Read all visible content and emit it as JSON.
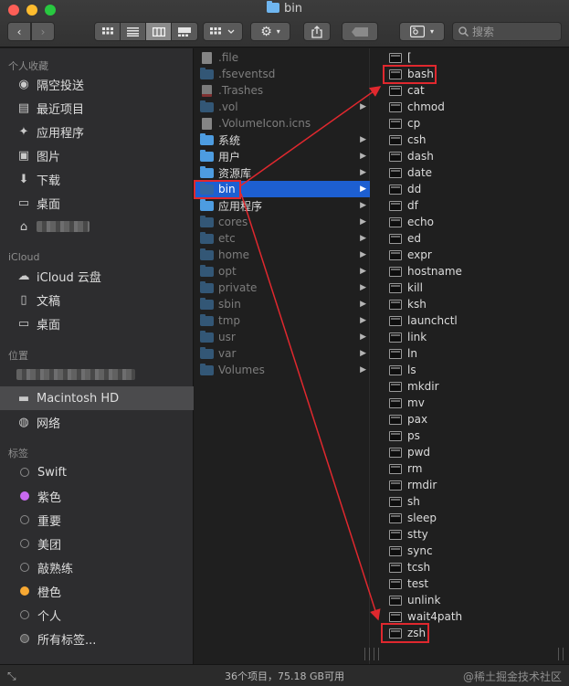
{
  "window": {
    "title": "bin"
  },
  "toolbar": {
    "back_glyph": "‹",
    "forward_glyph": "›",
    "search_placeholder": "搜索"
  },
  "sidebar": {
    "favorites_header": "个人收藏",
    "favorites": [
      {
        "label": "隔空投送",
        "icon": "airdrop-icon"
      },
      {
        "label": "最近项目",
        "icon": "recents-icon"
      },
      {
        "label": "应用程序",
        "icon": "applications-icon"
      },
      {
        "label": "图片",
        "icon": "pictures-icon"
      },
      {
        "label": "下载",
        "icon": "downloads-icon"
      },
      {
        "label": "桌面",
        "icon": "desktop-icon"
      },
      {
        "label": "",
        "icon": "home-icon"
      }
    ],
    "icloud_header": "iCloud",
    "icloud": [
      {
        "label": "iCloud 云盘",
        "icon": "cloud-icon"
      },
      {
        "label": "文稿",
        "icon": "documents-icon"
      },
      {
        "label": "桌面",
        "icon": "desktop-icon"
      }
    ],
    "locations_header": "位置",
    "locations": [
      {
        "label": "",
        "icon": "computer-icon"
      },
      {
        "label": "Macintosh HD",
        "icon": "disk-icon",
        "selected": true
      },
      {
        "label": "网络",
        "icon": "network-icon"
      }
    ],
    "tags_header": "标签",
    "tags": [
      {
        "label": "Swift",
        "color": "none"
      },
      {
        "label": "紫色",
        "color": "#c96af0"
      },
      {
        "label": "重要",
        "color": "none"
      },
      {
        "label": "美团",
        "color": "none"
      },
      {
        "label": "敲熟练",
        "color": "none"
      },
      {
        "label": "橙色",
        "color": "#f7a833"
      },
      {
        "label": "个人",
        "color": "none"
      },
      {
        "label": "所有标签...",
        "color": "multi"
      }
    ]
  },
  "column1": {
    "items": [
      {
        "name": ".file",
        "kind": "doc",
        "hidden": true
      },
      {
        "name": ".fseventsd",
        "kind": "folder",
        "hidden": true
      },
      {
        "name": ".Trashes",
        "kind": "trash",
        "hidden": true
      },
      {
        "name": ".vol",
        "kind": "folder",
        "hidden": true,
        "chevron": true
      },
      {
        "name": ".VolumeIcon.icns",
        "kind": "doc",
        "hidden": true
      },
      {
        "name": "系统",
        "kind": "folder",
        "chevron": true
      },
      {
        "name": "用户",
        "kind": "folder",
        "chevron": true
      },
      {
        "name": "资源库",
        "kind": "folder",
        "chevron": true
      },
      {
        "name": "bin",
        "kind": "folder",
        "chevron": true,
        "selected": true
      },
      {
        "name": "应用程序",
        "kind": "folder",
        "chevron": true
      },
      {
        "name": "cores",
        "kind": "folder",
        "hidden": true,
        "chevron": true
      },
      {
        "name": "etc",
        "kind": "folder",
        "hidden": true,
        "chevron": true
      },
      {
        "name": "home",
        "kind": "folder",
        "hidden": true,
        "chevron": true
      },
      {
        "name": "opt",
        "kind": "folder",
        "hidden": true,
        "chevron": true
      },
      {
        "name": "private",
        "kind": "folder",
        "hidden": true,
        "chevron": true
      },
      {
        "name": "sbin",
        "kind": "folder",
        "hidden": true,
        "chevron": true
      },
      {
        "name": "tmp",
        "kind": "folder",
        "hidden": true,
        "chevron": true
      },
      {
        "name": "usr",
        "kind": "folder",
        "hidden": true,
        "chevron": true
      },
      {
        "name": "var",
        "kind": "folder",
        "hidden": true,
        "chevron": true
      },
      {
        "name": "Volumes",
        "kind": "folder",
        "hidden": true,
        "chevron": true
      }
    ]
  },
  "column2": {
    "items": [
      "[",
      "bash",
      "cat",
      "chmod",
      "cp",
      "csh",
      "dash",
      "date",
      "dd",
      "df",
      "echo",
      "ed",
      "expr",
      "hostname",
      "kill",
      "ksh",
      "launchctl",
      "link",
      "ln",
      "ls",
      "mkdir",
      "mv",
      "pax",
      "ps",
      "pwd",
      "rm",
      "rmdir",
      "sh",
      "sleep",
      "stty",
      "sync",
      "tcsh",
      "test",
      "unlink",
      "wait4path",
      "zsh"
    ]
  },
  "status": {
    "summary": "36个项目，75.18 GB可用",
    "watermark": "@稀土掘金技术社区"
  },
  "annotation": {
    "color": "#e0282e"
  }
}
